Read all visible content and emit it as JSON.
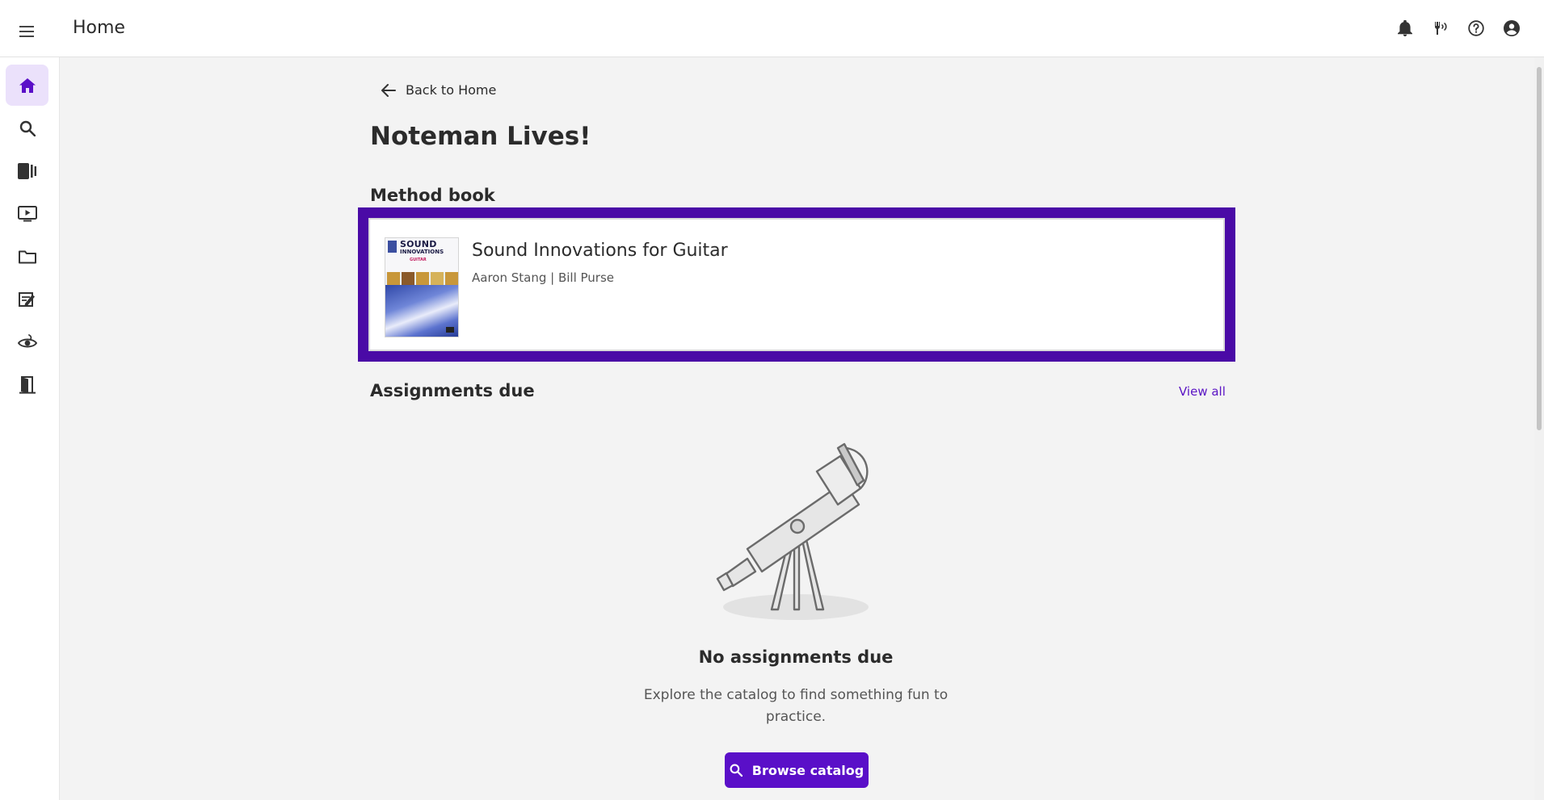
{
  "header": {
    "title": "Home",
    "icons": [
      "notifications-icon",
      "tuner-icon",
      "help-icon",
      "account-icon"
    ]
  },
  "sidebar": {
    "items": [
      {
        "name": "home",
        "icon": "home-icon",
        "active": true
      },
      {
        "name": "search",
        "icon": "search-icon",
        "active": false
      },
      {
        "name": "library",
        "icon": "library-icon",
        "active": false
      },
      {
        "name": "videos",
        "icon": "video-icon",
        "active": false
      },
      {
        "name": "folders",
        "icon": "folder-icon",
        "active": false
      },
      {
        "name": "assignments",
        "icon": "assignment-icon",
        "active": false
      },
      {
        "name": "ear-training",
        "icon": "ear-icon",
        "active": false
      },
      {
        "name": "exit",
        "icon": "door-icon",
        "active": false
      }
    ]
  },
  "main": {
    "back_label": "Back to Home",
    "page_title": "Noteman Lives!",
    "method_book_heading": "Method book",
    "book": {
      "title": "Sound Innovations for Guitar",
      "authors": "Aaron Stang | Bill Purse",
      "cover_title_line1": "SOUND",
      "cover_title_line2": "INNOVATIONS",
      "cover_subtitle": "GUITAR"
    },
    "assignments_heading": "Assignments due",
    "view_all_label": "View all",
    "empty_title": "No assignments due",
    "empty_description": "Explore the catalog to find something fun to practice.",
    "browse_label": "Browse catalog"
  },
  "colors": {
    "accent": "#5a0fc8",
    "highlight_outline": "#4a0aa6",
    "active_nav_bg": "#ebe1fb",
    "content_bg": "#f3f3f3"
  }
}
